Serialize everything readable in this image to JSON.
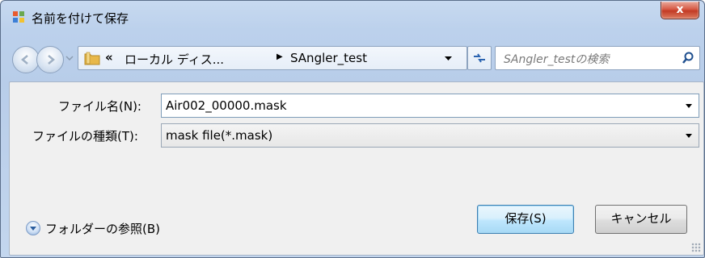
{
  "window": {
    "title": "名前を付けて保存",
    "close_label": "x"
  },
  "nav": {
    "address_chevron": "«",
    "address_path": "ローカル ディス...",
    "address_separator": "▶",
    "address_folder": "SAngler_test",
    "search_placeholder": "SAngler_testの検索"
  },
  "form": {
    "filename_label": "ファイル名(N):",
    "filename_value": "Air002_00000.mask",
    "filetype_label": "ファイルの種類(T):",
    "filetype_value": "mask file(*.mask)"
  },
  "footer": {
    "browse_label": "フォルダーの参照(B)",
    "save_label": "保存(S)",
    "cancel_label": "キャンセル"
  }
}
